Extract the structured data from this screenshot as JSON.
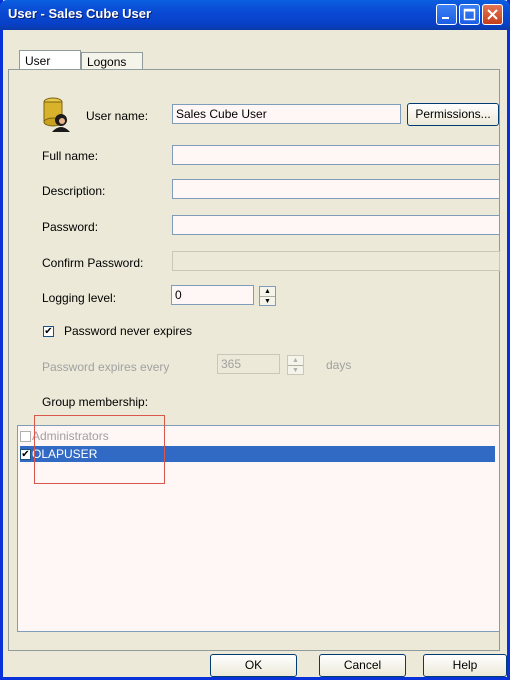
{
  "window": {
    "title": "User - Sales Cube User"
  },
  "tabs": [
    {
      "label": "User"
    },
    {
      "label": "Logons"
    }
  ],
  "form": {
    "user_name_label": "User name:",
    "user_name_value": "Sales Cube User",
    "permissions_button": "Permissions...",
    "full_name_label": "Full name:",
    "full_name_value": "",
    "description_label": "Description:",
    "description_value": "",
    "password_label": "Password:",
    "confirm_password_label": "Confirm Password:",
    "logging_level_label": "Logging level:",
    "logging_level_value": "0",
    "password_never_expires_label": "Password never expires",
    "password_never_expires_checked": true,
    "password_expires_every_label": "Password expires every",
    "password_expires_days_value": "365",
    "days_label": "days",
    "group_membership_label": "Group membership:"
  },
  "groups": [
    {
      "name": "Administrators",
      "checked": false,
      "selected": false,
      "enabled": false
    },
    {
      "name": "OLAPUSER",
      "checked": true,
      "selected": true,
      "enabled": true
    }
  ],
  "buttons": {
    "ok": "OK",
    "cancel": "Cancel",
    "help": "Help"
  },
  "colors": {
    "title_bar": "#0a49d4",
    "selection": "#316ac5",
    "annotation_box": "#d9564b",
    "field_bg": "#fff6f6"
  }
}
